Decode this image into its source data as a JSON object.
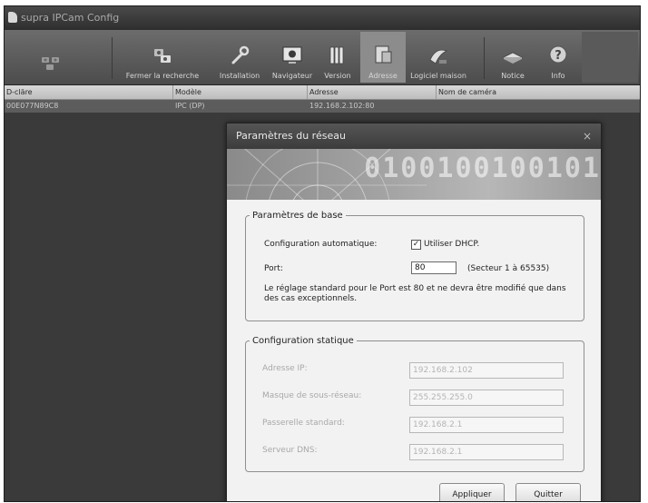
{
  "window": {
    "title": "supra IPCam Config"
  },
  "toolbar": {
    "buttons": [
      {
        "id": "search",
        "label": "",
        "icon": "search-cameras-icon"
      },
      {
        "id": "close_search",
        "label": "Fermer la recherche",
        "icon": "camera-search-icon"
      },
      {
        "id": "installation",
        "label": "Installation",
        "icon": "wrench-icon"
      },
      {
        "id": "browser",
        "label": "Navigateur",
        "icon": "monitor-icon"
      },
      {
        "id": "version",
        "label": "Version",
        "icon": "books-icon"
      },
      {
        "id": "address",
        "label": "Adresse",
        "icon": "address-icon",
        "active": true
      },
      {
        "id": "logiciel",
        "label": "Logiciel maison",
        "icon": "satellite-dish-icon"
      },
      {
        "id": "notice",
        "label": "Notice",
        "icon": "manual-icon"
      },
      {
        "id": "info",
        "label": "Info",
        "icon": "info-icon"
      }
    ]
  },
  "list": {
    "headers": [
      "D-cläre",
      "Modèle",
      "Adresse",
      "Nom de caméra"
    ],
    "rows": [
      {
        "id": "00E077N89C8",
        "model": "IPC (DP)",
        "address": "192.168.2.102:80",
        "name": ""
      }
    ]
  },
  "dialog": {
    "title": "Paramètres du réseau",
    "close_glyph": "×",
    "banner_text": "0100100100101",
    "basic": {
      "legend": "Paramètres de base",
      "auto_config_label": "Configuration automatique:",
      "dhcp_label": "Utiliser DHCP.",
      "dhcp_checked": true,
      "check_glyph": "✓",
      "port_label": "Port:",
      "port_value": "80",
      "port_hint": "(Secteur 1 à 65535)",
      "note": "Le réglage standard pour le Port est 80 et ne devra être modifié que dans des cas exceptionnels."
    },
    "static": {
      "legend": "Configuration statique",
      "fields": [
        {
          "label": "Adresse IP:",
          "value": "192.168.2.102"
        },
        {
          "label": "Masque de sous-réseau:",
          "value": "255.255.255.0"
        },
        {
          "label": "Passerelle standard:",
          "value": "192.168.2.1"
        },
        {
          "label": "Serveur DNS:",
          "value": "192.168.2.1"
        }
      ]
    },
    "apply_label": "Appliquer",
    "quit_label": "Quitter"
  }
}
